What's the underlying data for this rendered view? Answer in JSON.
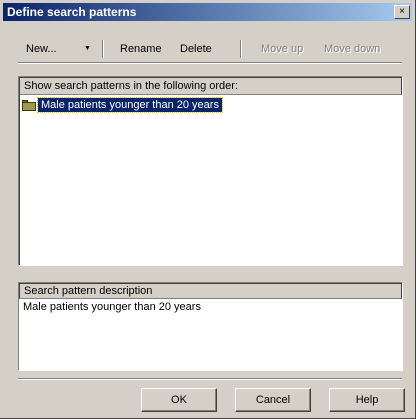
{
  "window": {
    "title": "Define search patterns",
    "close_glyph": "×"
  },
  "toolbar": {
    "new_label": "New...",
    "new_dropdown_glyph": "▼",
    "rename_label": "Rename",
    "delete_label": "Delete",
    "move_up_label": "Move up",
    "move_down_label": "Move down"
  },
  "patterns_list": {
    "header": "Show search patterns in the following order:",
    "items": [
      {
        "label": "Male patients younger than 20 years",
        "icon": "folder-icon",
        "selected": true
      }
    ]
  },
  "description": {
    "header": "Search pattern description",
    "text": "Male patients younger than 20 years"
  },
  "buttons": {
    "ok_label": "OK",
    "cancel_label": "Cancel",
    "help_label": "Help"
  },
  "colors": {
    "face": "#d4d0c8",
    "title_start": "#0a246a",
    "title_end": "#a6caf0",
    "selection": "#0a246a",
    "disabled_text": "#808080"
  }
}
